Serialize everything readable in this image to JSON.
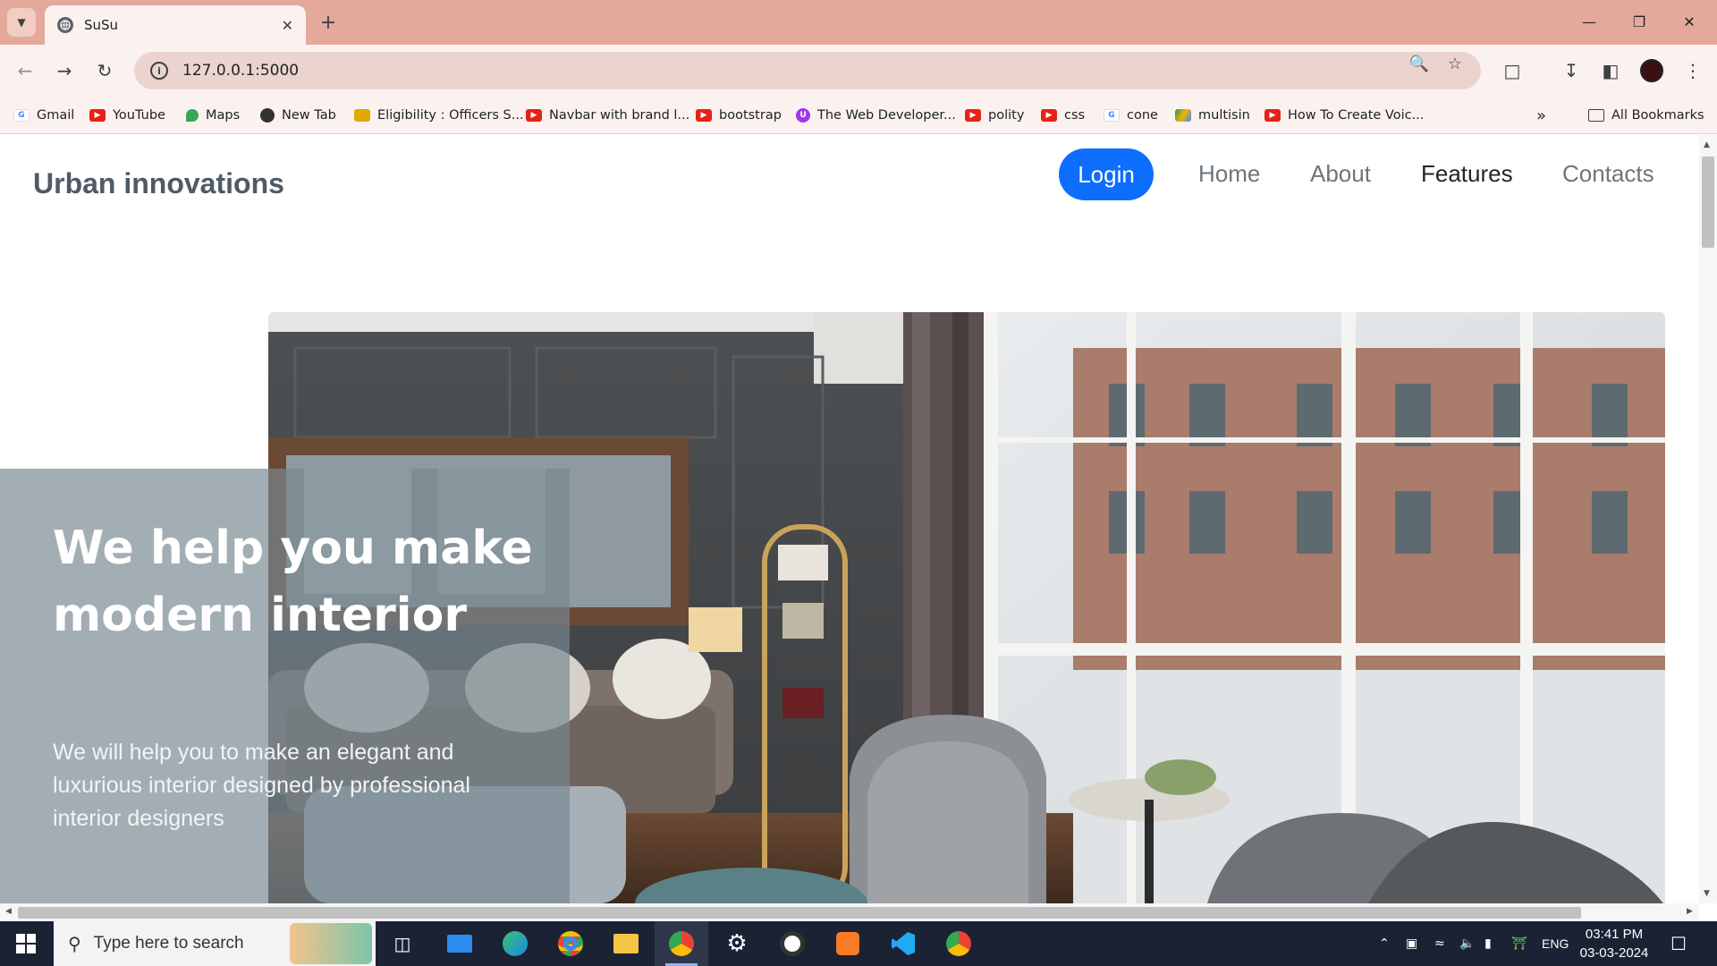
{
  "browser": {
    "tab_title": "SuSu",
    "url": "127.0.0.1:5000",
    "all_bookmarks_label": "All Bookmarks",
    "bookmarks": [
      {
        "label": "Gmail",
        "icon": "google-icon"
      },
      {
        "label": "YouTube",
        "icon": "youtube-icon"
      },
      {
        "label": "Maps",
        "icon": "maps-icon"
      },
      {
        "label": "New Tab",
        "icon": "globe-icon"
      },
      {
        "label": "Eligibility : Officers S...",
        "icon": "emblem-icon"
      },
      {
        "label": "Navbar with brand l...",
        "icon": "youtube-icon"
      },
      {
        "label": "bootstrap",
        "icon": "youtube-icon"
      },
      {
        "label": "The Web Developer...",
        "icon": "udemy-icon"
      },
      {
        "label": "polity",
        "icon": "youtube-icon"
      },
      {
        "label": "css",
        "icon": "youtube-icon"
      },
      {
        "label": "cone",
        "icon": "google-icon"
      },
      {
        "label": "multisin",
        "icon": "drive-icon"
      },
      {
        "label": "How To Create Voic...",
        "icon": "youtube-icon"
      }
    ]
  },
  "site": {
    "brand": "Urban innovations",
    "nav": {
      "login": "Login",
      "home": "Home",
      "about": "About",
      "features": "Features",
      "contacts": "Contacts"
    },
    "hero": {
      "title": "We help you make modern interior",
      "subtitle": "We will help you to make an elegant and luxurious interior designed by professional interior designers"
    }
  },
  "taskbar": {
    "search_placeholder": "Type here to search",
    "language": "ENG",
    "time": "03:41 PM",
    "date": "03-03-2024"
  },
  "colors": {
    "tabstrip": "#e5a99b",
    "toolbar": "#fbf2f0",
    "login_button": "#0d6efd",
    "hero_overlay": "rgba(120,135,145,0.68)",
    "taskbar": "#1b2233"
  }
}
